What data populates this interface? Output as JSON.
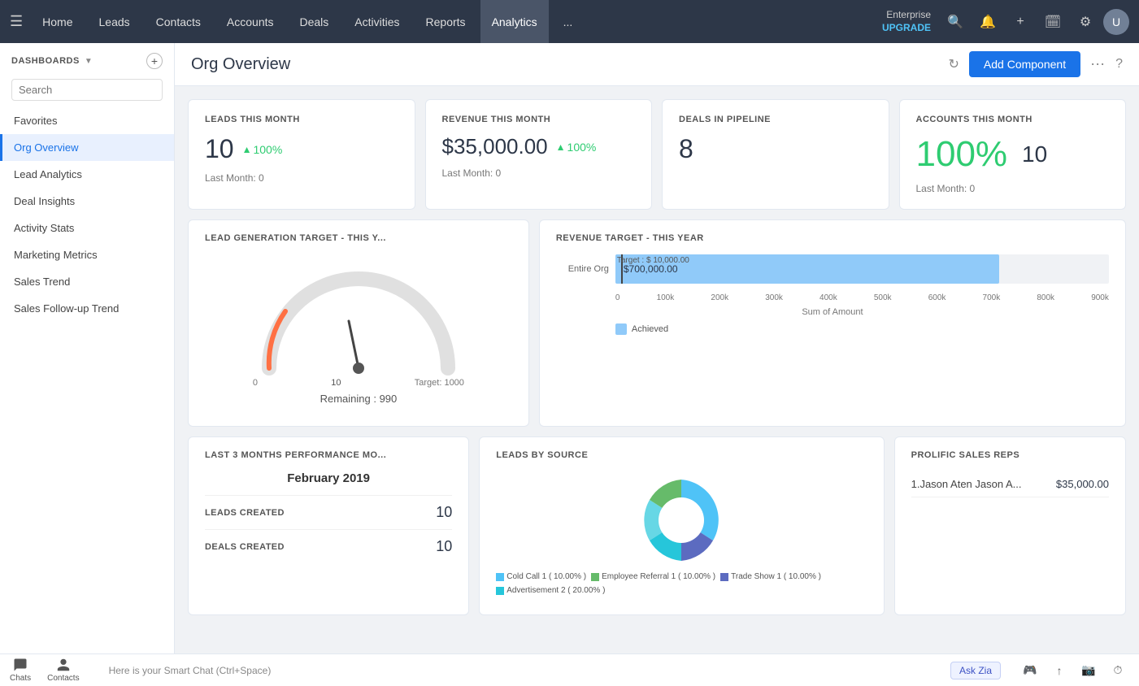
{
  "topnav": {
    "items": [
      {
        "label": "Home",
        "id": "home"
      },
      {
        "label": "Leads",
        "id": "leads"
      },
      {
        "label": "Contacts",
        "id": "contacts"
      },
      {
        "label": "Accounts",
        "id": "accounts"
      },
      {
        "label": "Deals",
        "id": "deals"
      },
      {
        "label": "Activities",
        "id": "activities"
      },
      {
        "label": "Reports",
        "id": "reports"
      },
      {
        "label": "Analytics",
        "id": "analytics",
        "active": true
      },
      {
        "label": "...",
        "id": "more"
      }
    ],
    "enterprise_label": "Enterprise",
    "upgrade_label": "UPGRADE"
  },
  "sidebar": {
    "title": "DASHBOARDS",
    "search_placeholder": "Search",
    "items": [
      {
        "label": "Favorites",
        "id": "favorites"
      },
      {
        "label": "Org Overview",
        "id": "org-overview",
        "active": true
      },
      {
        "label": "Lead Analytics",
        "id": "lead-analytics"
      },
      {
        "label": "Deal Insights",
        "id": "deal-insights"
      },
      {
        "label": "Activity Stats",
        "id": "activity-stats"
      },
      {
        "label": "Marketing Metrics",
        "id": "marketing-metrics"
      },
      {
        "label": "Sales Trend",
        "id": "sales-trend"
      },
      {
        "label": "Sales Follow-up Trend",
        "id": "sales-followup"
      }
    ]
  },
  "content": {
    "title": "Org Overview",
    "add_component_label": "Add Component"
  },
  "metrics": [
    {
      "label": "LEADS THIS MONTH",
      "value": "10",
      "pct": "100%",
      "footer": "Last Month: 0"
    },
    {
      "label": "REVENUE THIS MONTH",
      "value": "$35,000.00",
      "pct": "100%",
      "footer": "Last Month: 0"
    },
    {
      "label": "DEALS IN PIPELINE",
      "value": "8",
      "footer": ""
    },
    {
      "label": "ACCOUNTS THIS MONTH",
      "pct_value": "100%",
      "count": "10",
      "footer": "Last Month: 0"
    }
  ],
  "lead_gen": {
    "title": "LEAD GENERATION TARGET - THIS Y...",
    "current": 10,
    "target": 1000,
    "remaining": "Remaining : 990",
    "zero_label": "0",
    "target_label": "Target: 1000"
  },
  "revenue_target": {
    "title": "REVENUE TARGET - THIS YEAR",
    "bar_label": "Entire Org",
    "target_text": "Target : $ 10,000.00",
    "achieved_text": "$700,000.00",
    "bar_pct": 77.8,
    "x_labels": [
      "0",
      "100k",
      "200k",
      "300k",
      "400k",
      "500k",
      "600k",
      "700k",
      "800k",
      "900k"
    ],
    "x_axis_title": "Sum of Amount",
    "legend_label": "Achieved"
  },
  "perf": {
    "title": "LAST 3 MONTHS PERFORMANCE MO...",
    "month": "February 2019",
    "rows": [
      {
        "label": "LEADS CREATED",
        "value": "10"
      },
      {
        "label": "DEALS CREATED",
        "value": "10"
      }
    ]
  },
  "leads_by_source": {
    "title": "LEADS BY SOURCE",
    "segments": [
      {
        "label": "Cold Call",
        "detail": "1 ( 10.00% )",
        "color": "#4fc3f7"
      },
      {
        "label": "Employee Referral",
        "detail": "1 ( 10.00% )",
        "color": "#66bb6a"
      },
      {
        "label": "Trade Show",
        "detail": "1 ( 10.00% )",
        "color": "#5c6bc0"
      },
      {
        "label": "Advertisement",
        "detail": "2 ( 20.00% )",
        "color": "#26c6da"
      }
    ]
  },
  "prolific": {
    "title": "PROLIFIC SALES REPS",
    "items": [
      {
        "name": "1.Jason Aten Jason A...",
        "value": "$35,000.00"
      }
    ]
  },
  "bottom": {
    "smartchat_placeholder": "Here is your Smart Chat (Ctrl+Space)",
    "ask_zia": "Ask Zia",
    "nav_items": [
      {
        "label": "Chats",
        "id": "chats"
      },
      {
        "label": "Contacts",
        "id": "contacts"
      }
    ]
  }
}
